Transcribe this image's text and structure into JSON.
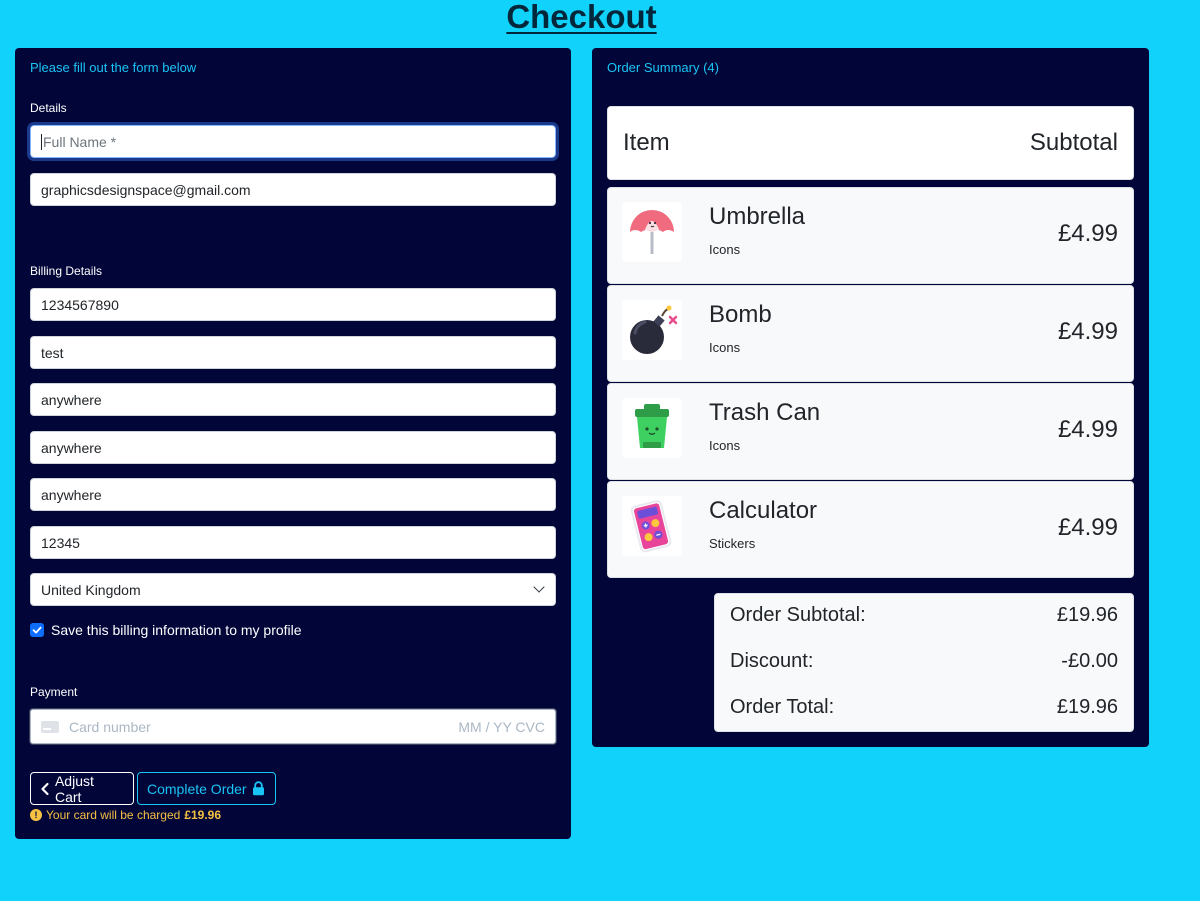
{
  "page": {
    "title": "Checkout"
  },
  "form": {
    "heading": "Please fill out the form below",
    "details_label": "Details",
    "full_name_placeholder": "Full Name *",
    "email_value": "graphicsdesignspace@gmail.com",
    "billing_label": "Billing Details",
    "billing_fields": [
      "1234567890",
      "test",
      "anywhere",
      "anywhere",
      "anywhere",
      "12345"
    ],
    "country_value": "United Kingdom",
    "save_billing_label": "Save this billing information to my profile",
    "save_billing_checked": true,
    "payment_label": "Payment",
    "card_placeholder": "Card number",
    "card_expiry_cvc_placeholder": "MM / YY  CVC",
    "adjust_cart_label": "Adjust Cart",
    "complete_order_label": "Complete Order",
    "charge_note_prefix": "Your card will be charged",
    "charge_amount": "£19.96"
  },
  "summary": {
    "heading": "Order Summary (4)",
    "col_item": "Item",
    "col_subtotal": "Subtotal",
    "items": [
      {
        "name": "Umbrella",
        "category": "Icons",
        "price": "£4.99",
        "icon": "umbrella-icon"
      },
      {
        "name": "Bomb",
        "category": "Icons",
        "price": "£4.99",
        "icon": "bomb-icon"
      },
      {
        "name": "Trash Can",
        "category": "Icons",
        "price": "£4.99",
        "icon": "trash-can-icon"
      },
      {
        "name": "Calculator",
        "category": "Stickers",
        "price": "£4.99",
        "icon": "calculator-icon"
      }
    ],
    "totals": {
      "subtotal_label": "Order Subtotal:",
      "subtotal_value": "£19.96",
      "discount_label": "Discount:",
      "discount_value": "-£0.00",
      "total_label": "Order Total:",
      "total_value": "£19.96"
    }
  },
  "colors": {
    "background": "#10d2fa",
    "panel": "#020538",
    "accent": "#19c5f4",
    "warning": "#f6c043"
  }
}
